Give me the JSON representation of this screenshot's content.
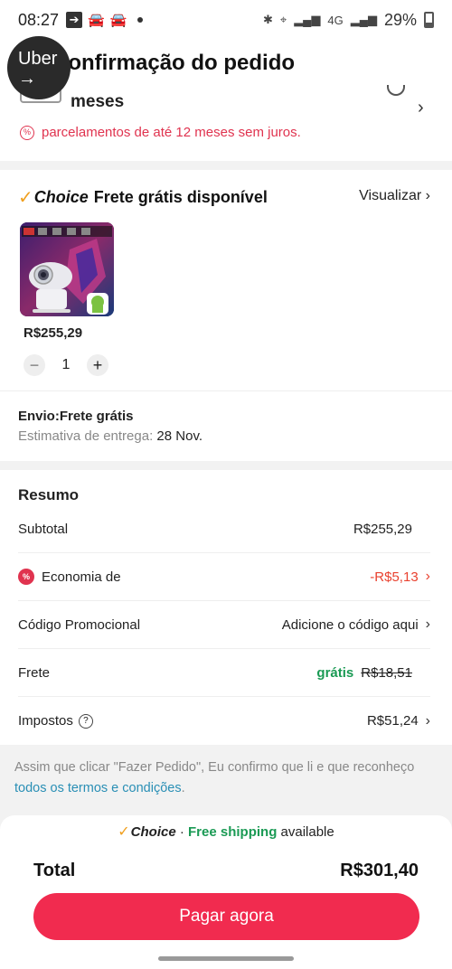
{
  "status": {
    "time": "08:27",
    "battery": "29%",
    "network": "4G"
  },
  "header": {
    "title": "Confirmação do pedido"
  },
  "overlay": {
    "uber_label": "Uber",
    "arrow": "→"
  },
  "installments": {
    "partial_title": "meses",
    "note": "parcelamentos de até 12 meses sem juros."
  },
  "shipping_card": {
    "choice": "Choice",
    "headline": "Frete grátis disponível",
    "view_label": "Visualizar",
    "product": {
      "price": "R$255,29",
      "quantity": "1"
    },
    "shipping_label": "Envio:Frete grátis",
    "estimate_label": "Estimativa de entrega:",
    "estimate_date": "28 Nov."
  },
  "summary": {
    "title": "Resumo",
    "subtotal_label": "Subtotal",
    "subtotal_value": "R$255,29",
    "savings_label": "Economia de",
    "savings_value": "-R$5,13",
    "promo_label": "Código Promocional",
    "promo_value": "Adicione o código aqui",
    "shipping_label": "Frete",
    "shipping_free": "grátis",
    "shipping_original": "R$18,51",
    "taxes_label": "Impostos",
    "taxes_value": "R$51,24"
  },
  "terms": {
    "text": "Assim que clicar \"Fazer Pedido\", Eu confirmo que li e que reconheço ",
    "link": "todos os termos e condições",
    "suffix": "."
  },
  "footer": {
    "banner_choice": "Choice",
    "banner_sep": " · ",
    "banner_free": "Free shipping",
    "banner_tail": " available",
    "total_label": "Total",
    "total_value": "R$301,40",
    "pay_label": "Pagar agora"
  },
  "colors": {
    "accent": "#f12b4f",
    "green": "#1a9a54",
    "discount": "#e9412f",
    "link": "#2a8fb5"
  }
}
